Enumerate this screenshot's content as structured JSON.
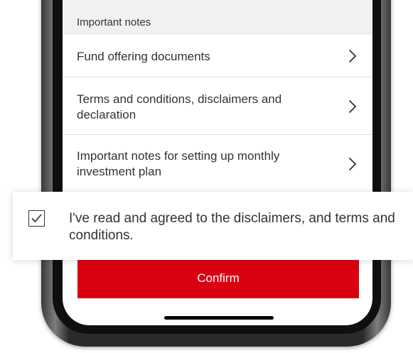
{
  "screen": {
    "section_header": "Important notes",
    "items": [
      {
        "label": "Fund offering documents",
        "icon": "chevron-right-icon"
      },
      {
        "label": "Terms and conditions, disclaimers and declaration",
        "icon": "chevron-right-icon"
      },
      {
        "label": "Important notes for setting up monthly investment plan",
        "icon": "chevron-right-icon"
      }
    ],
    "confirm_label": "Confirm"
  },
  "agreement": {
    "checked": true,
    "checkbox_icon": "checkmark-icon",
    "text": "I've read and agreed to the disclaimers, and terms and conditions."
  },
  "colors": {
    "brand_red": "#db0011",
    "header_bg": "#f1f1f1",
    "text": "#333333"
  }
}
